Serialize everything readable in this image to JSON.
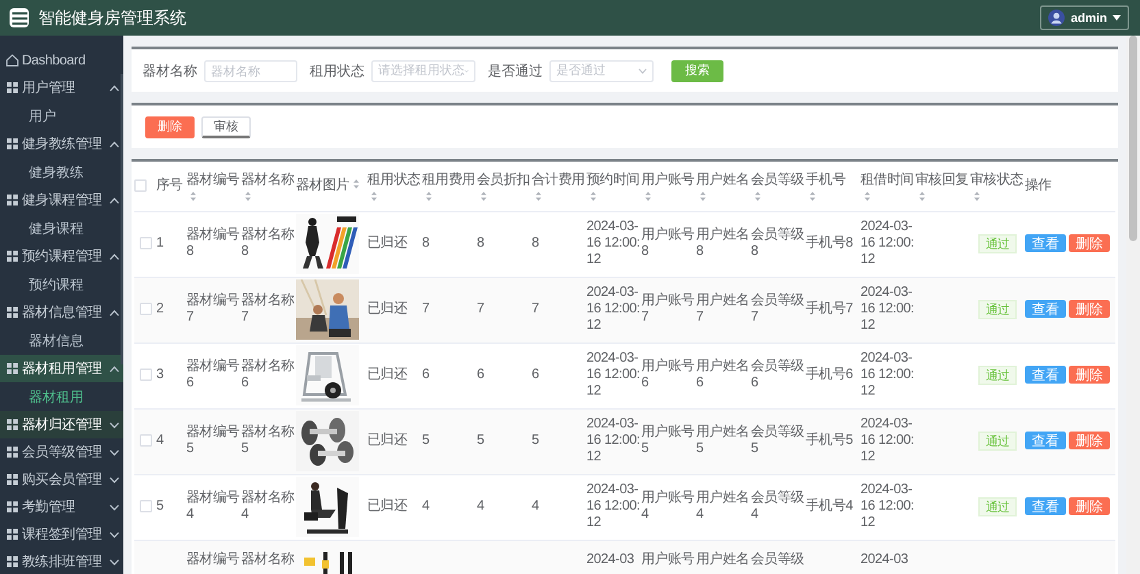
{
  "header": {
    "title": "智能健身房管理系统",
    "user": "admin"
  },
  "sidebar": {
    "items": [
      {
        "label": "Dashboard",
        "kind": "link",
        "selected": false,
        "hovered": false
      },
      {
        "label": "用户管理",
        "kind": "group",
        "expanded": true,
        "selected": false,
        "hovered": false,
        "children": [
          {
            "label": "用户",
            "selected": false
          }
        ]
      },
      {
        "label": "健身教练管理",
        "kind": "group",
        "expanded": true,
        "selected": false,
        "hovered": false,
        "children": [
          {
            "label": "健身教练",
            "selected": false
          }
        ]
      },
      {
        "label": "健身课程管理",
        "kind": "group",
        "expanded": true,
        "selected": false,
        "hovered": false,
        "children": [
          {
            "label": "健身课程",
            "selected": false
          }
        ]
      },
      {
        "label": "预约课程管理",
        "kind": "group",
        "expanded": true,
        "selected": false,
        "hovered": false,
        "children": [
          {
            "label": "预约课程",
            "selected": false
          }
        ]
      },
      {
        "label": "器材信息管理",
        "kind": "group",
        "expanded": true,
        "selected": false,
        "hovered": false,
        "children": [
          {
            "label": "器材信息",
            "selected": false
          }
        ]
      },
      {
        "label": "器材租用管理",
        "kind": "group",
        "expanded": true,
        "selected": true,
        "hovered": false,
        "children": [
          {
            "label": "器材租用",
            "selected": true
          }
        ]
      },
      {
        "label": "器材归还管理",
        "kind": "group",
        "expanded": false,
        "selected": false,
        "hovered": true
      },
      {
        "label": "会员等级管理",
        "kind": "group",
        "expanded": false,
        "selected": false,
        "hovered": false
      },
      {
        "label": "购买会员管理",
        "kind": "group",
        "expanded": false,
        "selected": false,
        "hovered": false
      },
      {
        "label": "考勤管理",
        "kind": "group",
        "expanded": false,
        "selected": false,
        "hovered": false
      },
      {
        "label": "课程签到管理",
        "kind": "group",
        "expanded": false,
        "selected": false,
        "hovered": false
      },
      {
        "label": "教练排班管理",
        "kind": "group",
        "expanded": false,
        "selected": false,
        "hovered": false
      }
    ]
  },
  "search": {
    "fields": [
      {
        "label": "器材名称",
        "kind": "input",
        "placeholder": "器材名称"
      },
      {
        "label": "租用状态",
        "kind": "select",
        "placeholder": "请选择租用状态"
      },
      {
        "label": "是否通过",
        "kind": "select",
        "placeholder": "是否通过"
      }
    ],
    "button": "搜索"
  },
  "toolbar": {
    "buttons": [
      {
        "label": "删除",
        "kind": "danger"
      },
      {
        "label": "审核",
        "kind": "plain"
      }
    ]
  },
  "table": {
    "select_all": {
      "checked": false
    },
    "columns": [
      {
        "label": "序号",
        "kind": "text",
        "sortable": false
      },
      {
        "label": "器材编号",
        "kind": "text",
        "sortable": true
      },
      {
        "label": "器材名称",
        "kind": "text",
        "sortable": true
      },
      {
        "label": "器材图片",
        "kind": "picture",
        "sortable": true
      },
      {
        "label": "租用状态",
        "kind": "text",
        "sortable": true
      },
      {
        "label": "租用费用",
        "kind": "text",
        "sortable": true
      },
      {
        "label": "会员折扣",
        "kind": "text",
        "sortable": true
      },
      {
        "label": "合计费用",
        "kind": "text",
        "sortable": true
      },
      {
        "label": "预约时间",
        "kind": "text",
        "sortable": true
      },
      {
        "label": "用户账号",
        "kind": "text",
        "sortable": true
      },
      {
        "label": "用户姓名",
        "kind": "text",
        "sortable": true
      },
      {
        "label": "会员等级",
        "kind": "text",
        "sortable": true
      },
      {
        "label": "手机号",
        "kind": "text",
        "sortable": true
      },
      {
        "label": "租借时间",
        "kind": "text",
        "sortable": true
      },
      {
        "label": "审核回复",
        "kind": "text",
        "sortable": true
      },
      {
        "label": "审核状态",
        "kind": "tag",
        "sortable": true
      },
      {
        "label": "操作",
        "kind": "actions",
        "sortable": false
      }
    ],
    "rows": [
      {
        "checked": false,
        "clipped": false,
        "cells": [
          "1",
          "器材编号8",
          "器材名称8",
          {
            "kind": "picture"
          },
          "已归还",
          "8",
          "8",
          "8",
          "2024-03-16 12:00:12",
          "用户账号8",
          "用户姓名8",
          "会员等级8",
          "手机号8",
          "2024-03-16 12:00:12",
          null,
          "通过",
          [
            "查看",
            "删除"
          ]
        ]
      },
      {
        "checked": false,
        "clipped": false,
        "cells": [
          "2",
          "器材编号7",
          "器材名称7",
          {
            "kind": "picture"
          },
          "已归还",
          "7",
          "7",
          "7",
          "2024-03-16 12:00:12",
          "用户账号7",
          "用户姓名7",
          "会员等级7",
          "手机号7",
          "2024-03-16 12:00:12",
          null,
          "通过",
          [
            "查看",
            "删除"
          ]
        ]
      },
      {
        "checked": false,
        "clipped": false,
        "cells": [
          "3",
          "器材编号6",
          "器材名称6",
          {
            "kind": "picture"
          },
          "已归还",
          "6",
          "6",
          "6",
          "2024-03-16 12:00:12",
          "用户账号6",
          "用户姓名6",
          "会员等级6",
          "手机号6",
          "2024-03-16 12:00:12",
          null,
          "通过",
          [
            "查看",
            "删除"
          ]
        ]
      },
      {
        "checked": false,
        "clipped": false,
        "cells": [
          "4",
          "器材编号5",
          "器材名称5",
          {
            "kind": "picture"
          },
          "已归还",
          "5",
          "5",
          "5",
          "2024-03-16 12:00:12",
          "用户账号5",
          "用户姓名5",
          "会员等级5",
          "手机号5",
          "2024-03-16 12:00:12",
          null,
          "通过",
          [
            "查看",
            "删除"
          ]
        ]
      },
      {
        "checked": false,
        "clipped": false,
        "cells": [
          "5",
          "器材编号4",
          "器材名称4",
          {
            "kind": "picture"
          },
          "已归还",
          "4",
          "4",
          "4",
          "2024-03-16 12:00:12",
          "用户账号4",
          "用户姓名4",
          "会员等级4",
          "手机号4",
          "2024-03-16 12:00:12",
          null,
          "通过",
          [
            "查看",
            "删除"
          ]
        ]
      },
      {
        "clipped": true,
        "cells": [
          null,
          "器材编号",
          "器材名称",
          {
            "kind": "picture"
          },
          null,
          null,
          null,
          null,
          "2024-03",
          "用户账号",
          "用户姓名",
          "会员等级",
          null,
          "2024-03",
          null,
          null,
          null
        ]
      }
    ]
  }
}
